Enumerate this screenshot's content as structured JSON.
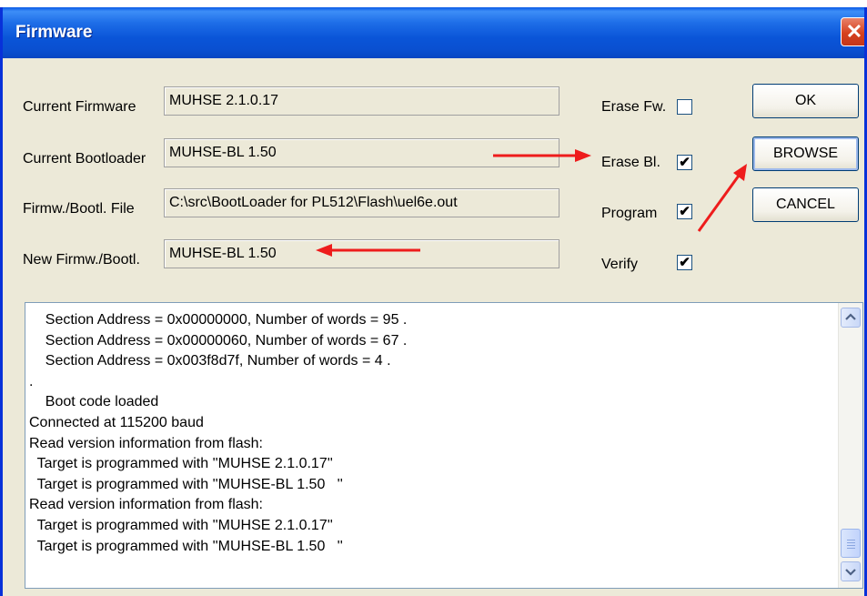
{
  "dialog": {
    "title": "Firmware",
    "close_glyph": "✕"
  },
  "fields": {
    "current_firmware": {
      "label": "Current Firmware",
      "value": "MUHSE 2.1.0.17"
    },
    "current_bootloader": {
      "label": "Current Bootloader",
      "value": "MUHSE-BL 1.50"
    },
    "file": {
      "label": "Firmw./Bootl. File",
      "value": "C:\\src\\BootLoader for PL512\\Flash\\uel6e.out"
    },
    "new": {
      "label": "New Firmw./Bootl.",
      "value": "MUHSE-BL 1.50"
    }
  },
  "options": {
    "erase_fw": {
      "label": "Erase Fw.",
      "checked": false,
      "mark": ""
    },
    "erase_bl": {
      "label": "Erase Bl.",
      "checked": true,
      "mark": "✔"
    },
    "program": {
      "label": "Program",
      "checked": true,
      "mark": "✔"
    },
    "verify": {
      "label": "Verify",
      "checked": true,
      "mark": "✔"
    }
  },
  "buttons": {
    "ok": "OK",
    "browse": "BROWSE",
    "cancel": "CANCEL"
  },
  "log": {
    "lines": [
      "    Section Address = 0x00000000, Number of words = 95 .",
      "    Section Address = 0x00000060, Number of words = 67 .",
      "    Section Address = 0x003f8d7f, Number of words = 4 .",
      ".",
      "    Boot code loaded",
      "Connected at 115200 baud",
      "Read version information from flash:",
      "  Target is programmed with ''MUHSE 2.1.0.17''",
      "  Target is programmed with ''MUHSE-BL 1.50   ''",
      "Read version information from flash:",
      "  Target is programmed with ''MUHSE 2.1.0.17''",
      "  Target is programmed with ''MUHSE-BL 1.50   ''"
    ]
  },
  "colors": {
    "titlebar": "#0a55d8",
    "annotation_arrow": "#ee1c1c",
    "dialog_bg": "#ece9d8"
  },
  "icons": {
    "scroll_up": "chevron-up-icon",
    "scroll_down": "chevron-down-icon",
    "close": "close-icon"
  }
}
